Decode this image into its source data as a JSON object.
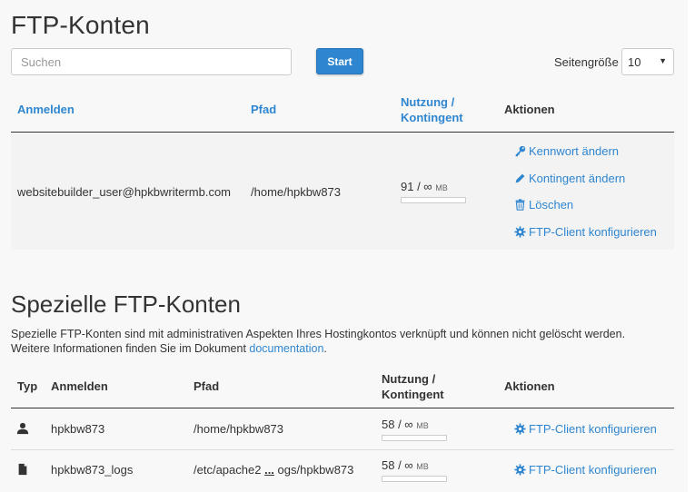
{
  "accounts": {
    "title": "FTP-Konten",
    "search": {
      "placeholder": "Suchen",
      "value": ""
    },
    "start_label": "Start",
    "page_size_label": "Seitengröße",
    "page_size_value": "10",
    "columns": {
      "login": "Anmelden",
      "path": "Pfad",
      "usage_line1": "Nutzung /",
      "usage_line2": "Kontingent",
      "actions": "Aktionen"
    },
    "rows": [
      {
        "login": "websitebuilder_user@hpkbwritermb.com",
        "path": "/home/hpkbw873",
        "usage": "91 / ∞",
        "unit": "MB",
        "actions": {
          "change_password": "Kennwort ändern",
          "change_quota": "Kontingent ändern",
          "delete": "Löschen",
          "configure_client": "FTP-Client konfigurieren"
        }
      }
    ]
  },
  "special": {
    "title": "Spezielle FTP-Konten",
    "description_line1": "Spezielle FTP-Konten sind mit administrativen Aspekten Ihres Hostingkontos verknüpft und können nicht gelöscht werden.",
    "description_line2_prefix": "Weitere Informationen finden Sie im Dokument ",
    "description_link": "documentation",
    "description_line2_suffix": ".",
    "columns": {
      "type": "Typ",
      "login": "Anmelden",
      "path": "Pfad",
      "usage_line1": "Nutzung /",
      "usage_line2": "Kontingent",
      "actions": "Aktionen"
    },
    "rows": [
      {
        "type_icon": "user-icon",
        "login": "hpkbw873",
        "path": "/home/hpkbw873",
        "usage": "58 / ∞",
        "unit": "MB",
        "action": "FTP-Client konfigurieren"
      },
      {
        "type_icon": "file-icon",
        "login": "hpkbw873_logs",
        "path_start": "/etc/apache2",
        "path_ellipsis": "...",
        "path_end": "ogs/hpkbw873",
        "usage": "58 / ∞",
        "unit": "MB",
        "action": "FTP-Client konfigurieren"
      }
    ]
  },
  "colors": {
    "link": "#2f86d0",
    "button": "#2f86d0",
    "text": "#333333",
    "background": "#f8f8f8"
  }
}
